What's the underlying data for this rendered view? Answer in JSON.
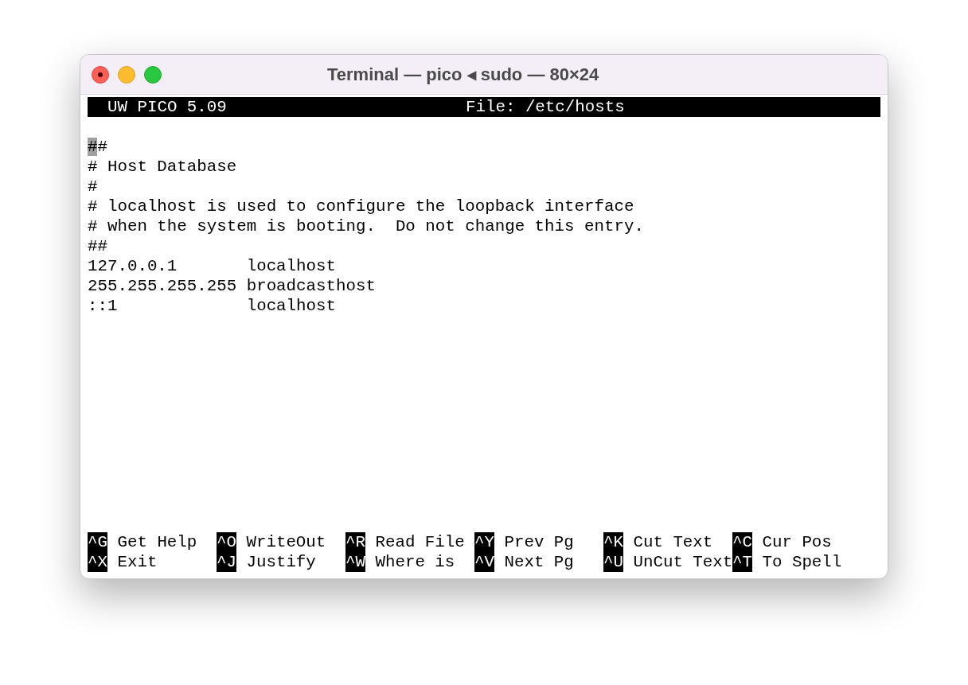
{
  "window": {
    "title": "Terminal — pico ◂ sudo — 80×24"
  },
  "header": {
    "app": "UW PICO 5.09",
    "file": "File: /etc/hosts"
  },
  "lines": [
    {
      "cursor_text": "#",
      "text": "#"
    },
    {
      "text": "# Host Database"
    },
    {
      "text": "#"
    },
    {
      "text": "# localhost is used to configure the loopback interface"
    },
    {
      "text": "# when the system is booting.  Do not change this entry."
    },
    {
      "text": "##"
    },
    {
      "text": "127.0.0.1       localhost"
    },
    {
      "text": "255.255.255.255 broadcasthost"
    },
    {
      "text": "::1             localhost"
    }
  ],
  "shortcuts": [
    [
      {
        "key": "^G",
        "label": "Get Help"
      },
      {
        "key": "^O",
        "label": "WriteOut"
      },
      {
        "key": "^R",
        "label": "Read File"
      },
      {
        "key": "^Y",
        "label": "Prev Pg"
      },
      {
        "key": "^K",
        "label": "Cut Text"
      },
      {
        "key": "^C",
        "label": "Cur Pos"
      }
    ],
    [
      {
        "key": "^X",
        "label": "Exit"
      },
      {
        "key": "^J",
        "label": "Justify"
      },
      {
        "key": "^W",
        "label": "Where is"
      },
      {
        "key": "^V",
        "label": "Next Pg"
      },
      {
        "key": "^U",
        "label": "UnCut Text"
      },
      {
        "key": "^T",
        "label": "To Spell"
      }
    ]
  ]
}
